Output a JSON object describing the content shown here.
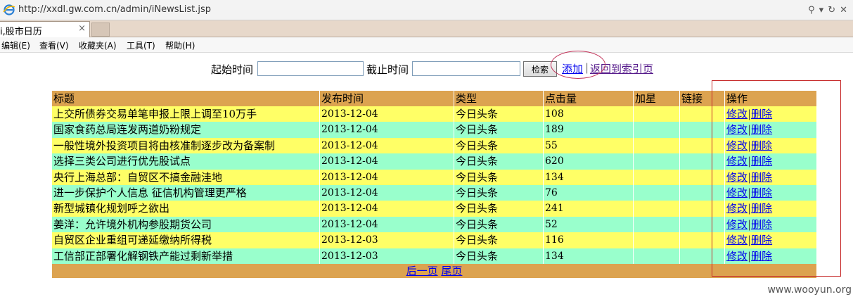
{
  "browser": {
    "url": "http://xxdl.gw.com.cn/admin/iNewsList.jsp",
    "tab_title": "i,股市日历",
    "tab_close": "×"
  },
  "menu": [
    "编辑(E)",
    "查看(V)",
    "收藏夹(A)",
    "工具(T)",
    "帮助(H)"
  ],
  "search": {
    "start_label": "起始时间",
    "end_label": "截止时间",
    "search_button": "检索",
    "add_link": "添加",
    "separator": "|",
    "back_link": "返回到索引页"
  },
  "table": {
    "headers": [
      "标题",
      "发布时间",
      "类型",
      "点击量",
      "加星",
      "链接",
      "操作"
    ],
    "rows": [
      {
        "title": "上交所债券交易单笔申报上限上调至10万手",
        "date": "2013-12-04",
        "type": "今日头条",
        "clicks": "108"
      },
      {
        "title": "国家食药总局连发两道奶粉规定",
        "date": "2013-12-04",
        "type": "今日头条",
        "clicks": "189"
      },
      {
        "title": "一般性境外投资项目将由核准制逐步改为备案制",
        "date": "2013-12-04",
        "type": "今日头条",
        "clicks": "55"
      },
      {
        "title": "选择三类公司进行优先股试点",
        "date": "2013-12-04",
        "type": "今日头条",
        "clicks": "620"
      },
      {
        "title": "央行上海总部：自贸区不搞金融洼地",
        "date": "2013-12-04",
        "type": "今日头条",
        "clicks": "134"
      },
      {
        "title": "进一步保护个人信息 征信机构管理更严格",
        "date": "2013-12-04",
        "type": "今日头条",
        "clicks": "76"
      },
      {
        "title": "新型城镇化规划呼之欲出",
        "date": "2013-12-04",
        "type": "今日头条",
        "clicks": "241"
      },
      {
        "title": "姜洋：允许境外机构参股期货公司",
        "date": "2013-12-04",
        "type": "今日头条",
        "clicks": "52"
      },
      {
        "title": "自贸区企业重组可递延缴纳所得税",
        "date": "2013-12-03",
        "type": "今日头条",
        "clicks": "116"
      },
      {
        "title": "工信部正部署化解钢铁产能过剩新举措",
        "date": "2013-12-03",
        "type": "今日头条",
        "clicks": "134"
      }
    ],
    "edit_label": "修改",
    "op_separator": "|",
    "delete_label": "删除"
  },
  "pager": {
    "next": "后一页",
    "last": "尾页"
  },
  "watermark": "www.wooyun.org",
  "colors": {
    "header_bg": "#dca350",
    "row_odd": "#ffff66",
    "row_even": "#99ffcc",
    "annotation_red": "#c62828"
  }
}
